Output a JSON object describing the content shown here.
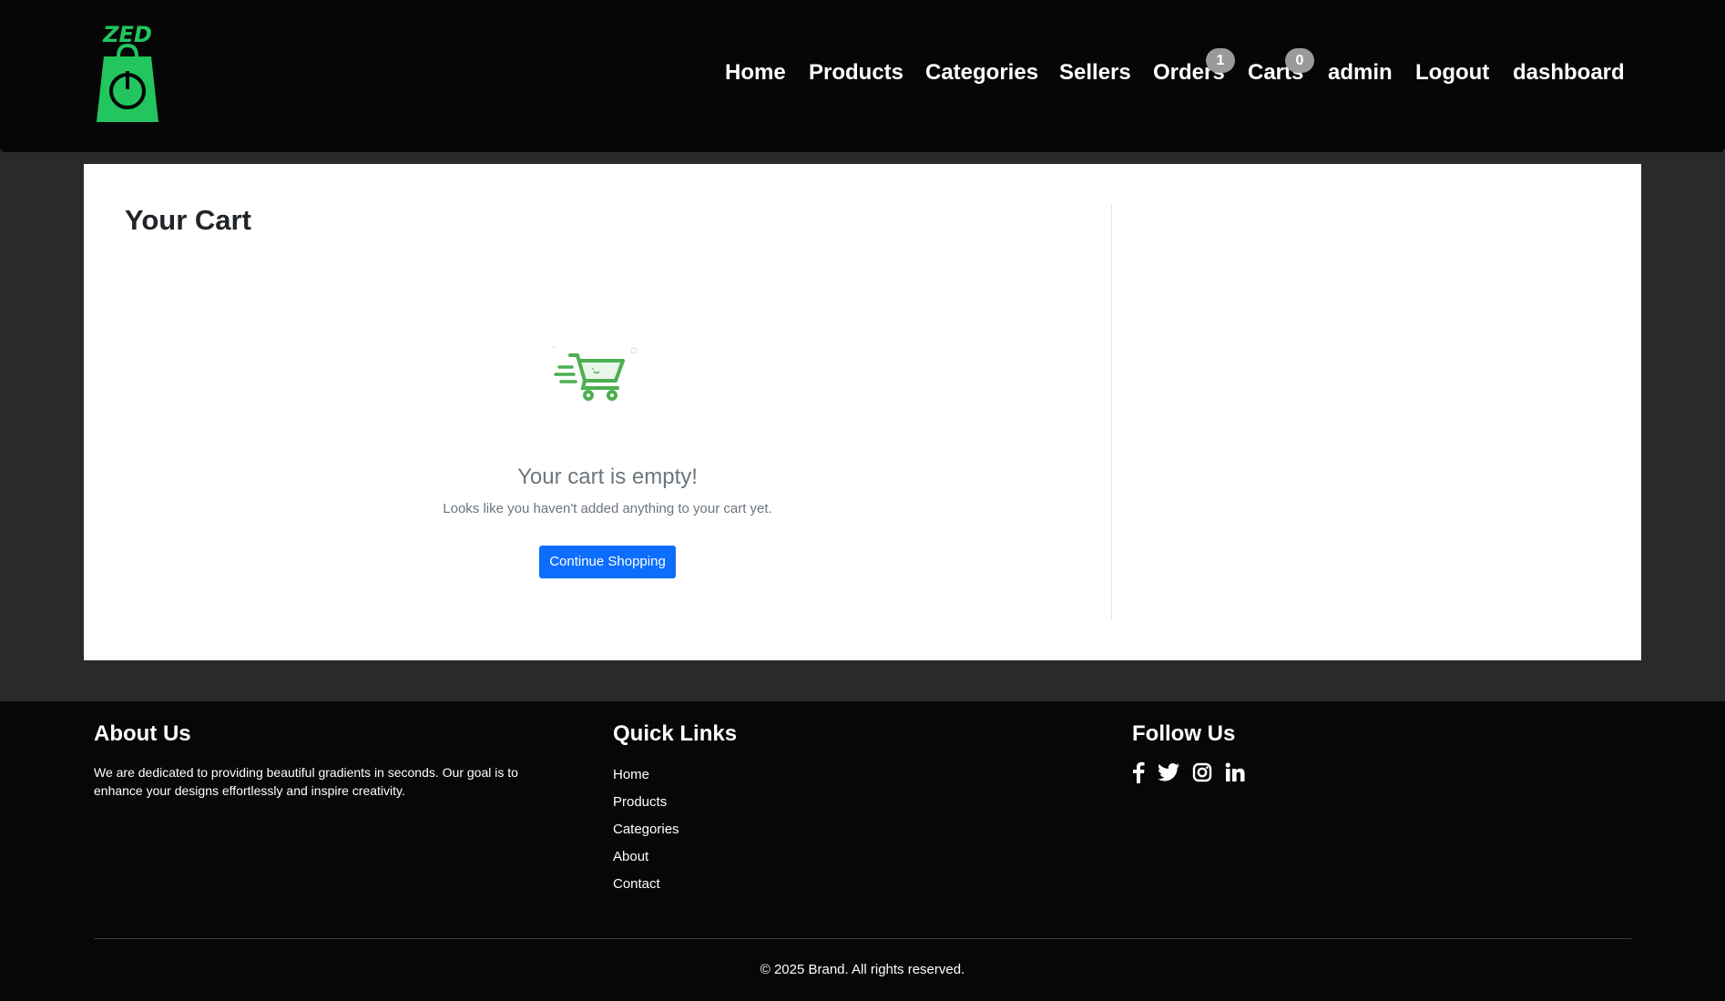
{
  "brand": {
    "logo_text": "ZED",
    "accent_color": "#22c55e"
  },
  "nav": {
    "items": [
      {
        "label": "Home"
      },
      {
        "label": "Products"
      },
      {
        "label": "Categories"
      },
      {
        "label": "Sellers"
      },
      {
        "label": "Orders",
        "badge": "1"
      },
      {
        "label": "Carts",
        "badge": "0"
      },
      {
        "label": "admin"
      },
      {
        "label": "Logout"
      },
      {
        "label": "dashboard"
      }
    ]
  },
  "cart": {
    "title": "Your Cart",
    "empty_title": "Your cart is empty!",
    "empty_message": "Looks like you haven't added anything to your cart yet.",
    "continue_button": "Continue Shopping",
    "button_color": "#0d6efd"
  },
  "footer": {
    "about": {
      "heading": "About Us",
      "text": "We are dedicated to providing beautiful gradients in seconds. Our goal is to enhance your designs effortlessly and inspire creativity."
    },
    "quick_links": {
      "heading": "Quick Links",
      "items": [
        "Home",
        "Products",
        "Categories",
        "About",
        "Contact"
      ]
    },
    "follow": {
      "heading": "Follow Us",
      "icons": [
        "facebook-icon",
        "twitter-icon",
        "instagram-icon",
        "linkedin-icon"
      ]
    },
    "copyright": "© 2025 Brand. All rights reserved."
  }
}
